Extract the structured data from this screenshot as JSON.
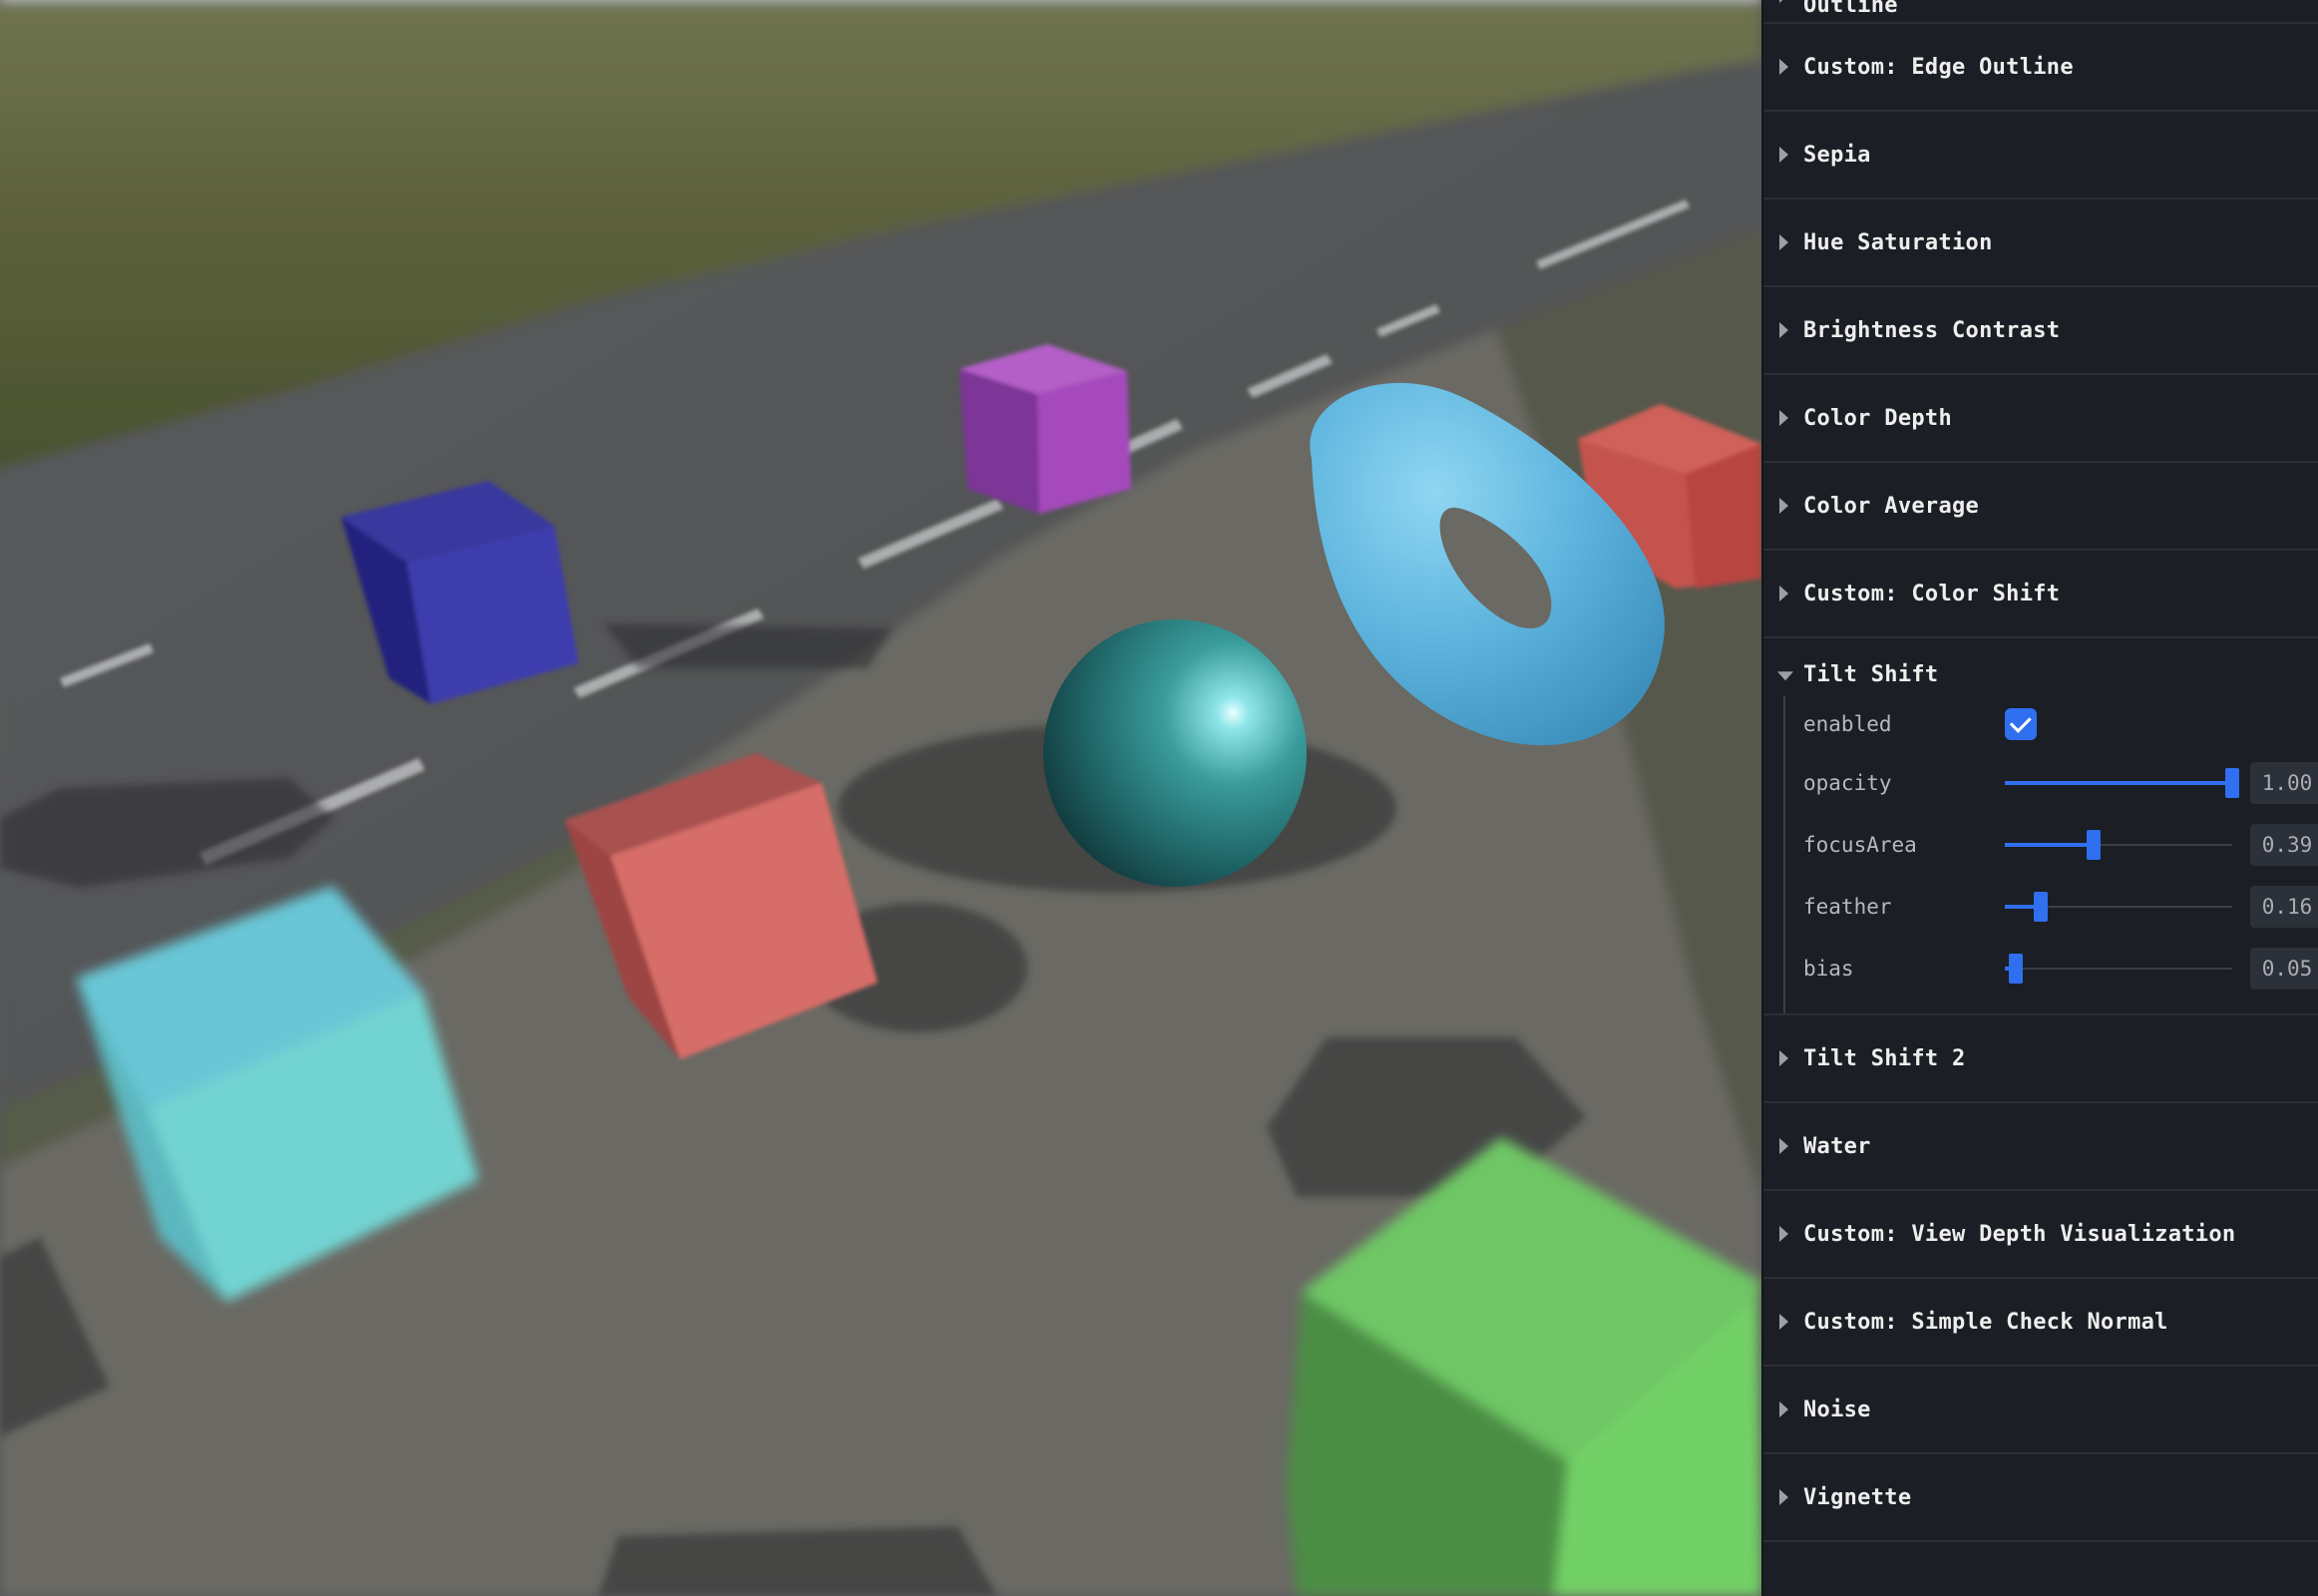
{
  "panel": {
    "folders": [
      {
        "title": "Outline",
        "open": false
      },
      {
        "title": "Custom: Edge Outline",
        "open": false
      },
      {
        "title": "Sepia",
        "open": false
      },
      {
        "title": "Hue Saturation",
        "open": false
      },
      {
        "title": "Brightness Contrast",
        "open": false
      },
      {
        "title": "Color Depth",
        "open": false
      },
      {
        "title": "Color Average",
        "open": false
      },
      {
        "title": "Custom: Color Shift",
        "open": false
      },
      {
        "title": "Tilt Shift",
        "open": true
      },
      {
        "title": "Tilt Shift 2",
        "open": false
      },
      {
        "title": "Water",
        "open": false
      },
      {
        "title": "Custom: View Depth Visualization",
        "open": false
      },
      {
        "title": "Custom: Simple Check Normal",
        "open": false
      },
      {
        "title": "Noise",
        "open": false
      },
      {
        "title": "Vignette",
        "open": false
      }
    ],
    "tilt_shift": {
      "enabled": {
        "label": "enabled",
        "checked": true
      },
      "sliders": [
        {
          "key": "opacity",
          "label": "opacity",
          "value": 1.0,
          "display": "1.00",
          "min": 0,
          "max": 1
        },
        {
          "key": "focusArea",
          "label": "focusArea",
          "value": 0.39,
          "display": "0.39",
          "min": 0,
          "max": 1
        },
        {
          "key": "feather",
          "label": "feather",
          "value": 0.16,
          "display": "0.16",
          "min": 0,
          "max": 1
        },
        {
          "key": "bias",
          "label": "bias",
          "value": 0.05,
          "display": "0.05",
          "min": 0,
          "max": 1
        }
      ]
    },
    "accent_color": "#2f6ff0"
  },
  "scene": {
    "objects": [
      {
        "name": "blue-cube",
        "color": "#3a3ab0"
      },
      {
        "name": "purple-cube",
        "color": "#a24bbd"
      },
      {
        "name": "red-cube-back",
        "color": "#c0524c"
      },
      {
        "name": "torus",
        "color": "#5cb3dd"
      },
      {
        "name": "sphere",
        "color": "#2f8d8b"
      },
      {
        "name": "red-cube",
        "color": "#d46a66"
      },
      {
        "name": "cyan-cube",
        "color": "#6fd4d4"
      },
      {
        "name": "green-cube",
        "color": "#6cc962"
      }
    ]
  }
}
